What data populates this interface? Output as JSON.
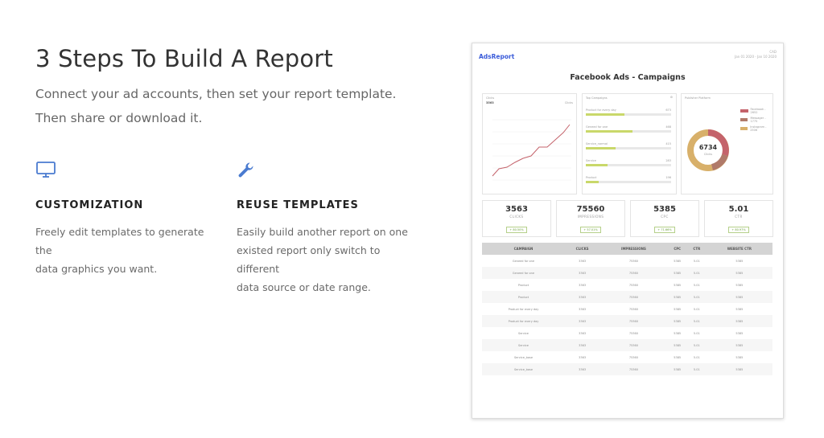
{
  "heading": "3 Steps To Build A Report",
  "subtitle_line1": "Connect your ad accounts, then set your report template.",
  "subtitle_line2": "Then share or download it.",
  "features": [
    {
      "icon": "monitor-icon",
      "title": "CUSTOMIZATION",
      "line1": "Freely edit templates to generate the",
      "line2": "data graphics you want."
    },
    {
      "icon": "wrench-icon",
      "title": "REUSE TEMPLATES",
      "line1": "Easily build another report on one",
      "line2": "existed report only switch to different",
      "line3": "data source or date range."
    }
  ],
  "colors": {
    "accent": "#4a7bd0",
    "line": "#c4636b",
    "bar": "#c9d86a",
    "donut": [
      "#c4636b",
      "#d8b06a",
      "#c9a87a"
    ]
  },
  "report": {
    "brand": "AdsReport",
    "info_line1": "CAD",
    "info_line2": "Jan 01 2020 - Jan 10 2020",
    "title": "Facebook Ads - Campaigns",
    "line_panel": {
      "title": "Clicks",
      "total": "3563",
      "legend": "Clicks"
    },
    "bars_panel": {
      "title": "Top Campaigns",
      "items": [
        {
          "label": "Product for every day",
          "value": "673",
          "fill": 0.45
        },
        {
          "label": "Geneed for one",
          "value": "468",
          "fill": 0.55
        },
        {
          "label": "Service_normal",
          "value": "415",
          "fill": 0.35
        },
        {
          "label": "Service",
          "value": "283",
          "fill": 0.25
        },
        {
          "label": "Product",
          "value": "196",
          "fill": 0.15
        }
      ]
    },
    "donut_panel": {
      "title": "Publisher Platform",
      "total": "6734",
      "total_label": "Clicks",
      "legend": [
        "Facebook - 2652",
        "Messager - 1775",
        "Instagram - 2506"
      ]
    },
    "kpis": [
      {
        "value": "3563",
        "label": "CLICKS",
        "change": "+ 80.50%"
      },
      {
        "value": "75560",
        "label": "IMPRESSIONS",
        "change": "+ 57.01%"
      },
      {
        "value": "5385",
        "label": "CPC",
        "change": "+ 71.66%"
      },
      {
        "value": "5.01",
        "label": "CTR",
        "change": "+ 80.97%"
      }
    ],
    "table": {
      "headers": [
        "CAMPAIGN",
        "CLICKS",
        "IMPRESSIONS",
        "CPC",
        "CTR",
        "WEBSITE CTR"
      ],
      "rows": [
        [
          "Geneed for one",
          "3363",
          "75360",
          "5385",
          "5.01",
          "5385"
        ],
        [
          "Geneed for one",
          "3363",
          "75360",
          "5385",
          "5.01",
          "5385"
        ],
        [
          "Product",
          "3363",
          "75360",
          "5385",
          "5.01",
          "5385"
        ],
        [
          "Product",
          "3363",
          "75360",
          "5385",
          "5.01",
          "5385"
        ],
        [
          "Product for every day",
          "3363",
          "75360",
          "5385",
          "5.01",
          "5385"
        ],
        [
          "Product for every day",
          "3363",
          "75360",
          "5385",
          "5.01",
          "5385"
        ],
        [
          "Service",
          "3363",
          "75360",
          "5385",
          "5.01",
          "5385"
        ],
        [
          "Service",
          "3363",
          "75360",
          "5385",
          "5.01",
          "5385"
        ],
        [
          "Service_base",
          "3363",
          "75360",
          "5385",
          "5.01",
          "5385"
        ],
        [
          "Service_base",
          "3363",
          "75360",
          "5385",
          "5.01",
          "5385"
        ]
      ]
    }
  }
}
